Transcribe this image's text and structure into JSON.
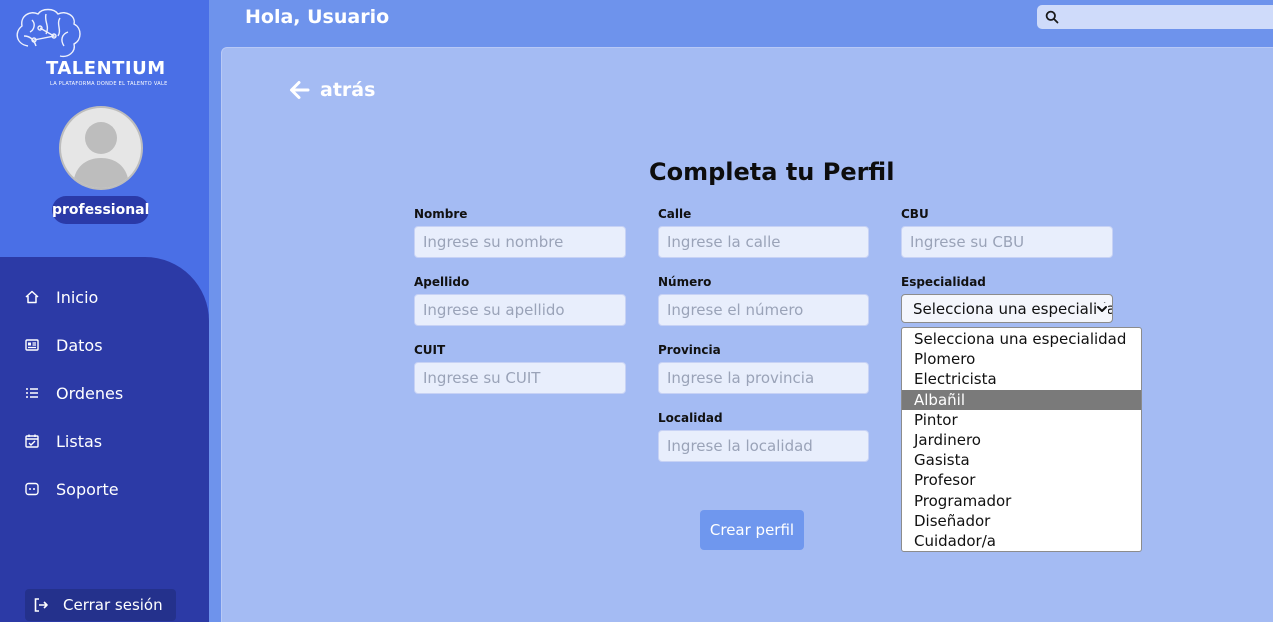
{
  "brand": {
    "name": "TALENTIUM",
    "tagline": "LA PLATAFORMA DONDE EL TALENTO VALE"
  },
  "user": {
    "role_badge": "professional"
  },
  "header": {
    "greeting": "Hola, Usuario",
    "search_placeholder": ""
  },
  "nav": {
    "items": [
      {
        "label": "Inicio",
        "icon": "home-icon"
      },
      {
        "label": "Datos",
        "icon": "id-card-icon"
      },
      {
        "label": "Ordenes",
        "icon": "list-icon"
      },
      {
        "label": "Listas",
        "icon": "calendar-check-icon"
      },
      {
        "label": "Soporte",
        "icon": "chat-icon"
      }
    ],
    "logout_label": "Cerrar sesión"
  },
  "page": {
    "back_label": "atrás",
    "title": "Completa tu Perfil",
    "submit_label": "Crear perfil"
  },
  "form": {
    "nombre": {
      "label": "Nombre",
      "placeholder": "Ingrese su nombre"
    },
    "apellido": {
      "label": "Apellido",
      "placeholder": "Ingrese su apellido"
    },
    "cuit": {
      "label": "CUIT",
      "placeholder": "Ingrese su CUIT"
    },
    "calle": {
      "label": "Calle",
      "placeholder": "Ingrese la calle"
    },
    "numero": {
      "label": "Número",
      "placeholder": "Ingrese el número"
    },
    "provincia": {
      "label": "Provincia",
      "placeholder": "Ingrese la provincia"
    },
    "localidad": {
      "label": "Localidad",
      "placeholder": "Ingrese la localidad"
    },
    "cbu": {
      "label": "CBU",
      "placeholder": "Ingrese su CBU"
    },
    "especialidad": {
      "label": "Especialidad",
      "selected": "Selecciona una especialidad",
      "highlighted": "Albañil",
      "options": [
        "Selecciona una especialidad",
        "Plomero",
        "Electricista",
        "Albañil",
        "Pintor",
        "Jardinero",
        "Gasista",
        "Profesor",
        "Programador",
        "Diseñador",
        "Cuidador/a"
      ]
    }
  },
  "colors": {
    "sidebar": "#4a6fe6",
    "nav_panel": "#2c3aa6",
    "header_bg": "#6e93ec",
    "main_panel": "#a4bbf3",
    "submit": "#6f97ee"
  }
}
